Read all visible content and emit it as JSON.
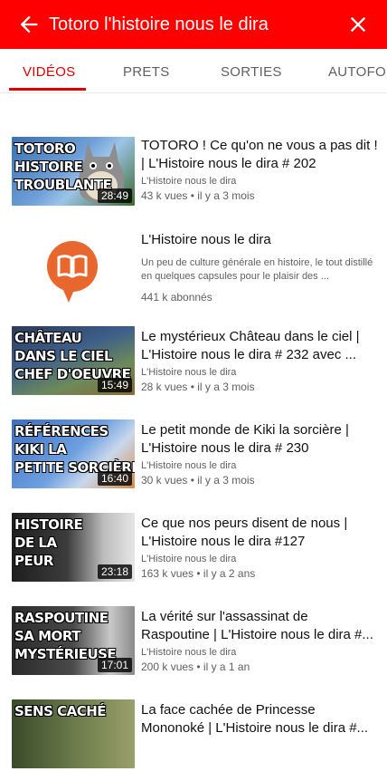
{
  "header": {
    "title": "Totoro l'histoire nous le dira",
    "back_icon": "arrow-left-icon",
    "close_icon": "close-icon",
    "background": "#ff0000"
  },
  "tabs": [
    {
      "label": "VIDÉOS",
      "active": true
    },
    {
      "label": "PRETS",
      "active": false
    },
    {
      "label": "SORTIES",
      "active": false
    },
    {
      "label": "AUTOFOR",
      "active": false
    }
  ],
  "results": {
    "video1": {
      "thumb_text": "TOTORO\nHISTOIRE\nTROUBLANTE",
      "duration": "28:49",
      "title": "TOTORO ! Ce qu'on ne vous a pas dit ! | L'Histoire nous le dira # 202",
      "channel": "L'Histoire nous le dira",
      "stats": "43 k vues • il y a 3 mois"
    },
    "channel": {
      "name": "L'Histoire nous le dira",
      "description": "Un peu de culture générale en histoire, le tout distillé en quelques capsules pour le plaisir des ...",
      "subscribers": "441 k abonnés",
      "icon": "book-icon"
    },
    "video2": {
      "thumb_text": "CHÂTEAU\nDANS LE CIEL\nCHEF D'OEUVRE",
      "duration": "15:49",
      "title": "Le mystérieux Château dans le ciel | L'Histoire nous le dira # 232 avec ...",
      "channel": "L'Histoire nous le dira",
      "stats": "28 k vues • il y a 3 mois"
    },
    "video3": {
      "thumb_text": "RÉFÉRENCES\nKIKI LA\nPETITE SORCIÈRE",
      "duration": "16:40",
      "title": "Le petit monde de Kiki la sorcière | L'Histoire nous le dira # 230",
      "channel": "L'Histoire nous le dira",
      "stats": "30 k vues • il y a 3 mois"
    },
    "video4": {
      "thumb_text": "HISTOIRE\nDE LA\nPEUR",
      "duration": "23:18",
      "title": "Ce que nos peurs disent de nous | L'Histoire nous le dira #127",
      "channel": "L'Histoire nous le dira",
      "stats": "163 k vues • il y a 2 ans"
    },
    "video5": {
      "thumb_text": "RASPOUTINE\nSA MORT\nMYSTÉRIEUSE",
      "duration": "17:01",
      "title": "La vérité sur l'assassinat de Raspoutine | L'Histoire nous le dira #...",
      "channel": "L'Histoire nous le dira",
      "stats": "200 k vues • il y a 1 an"
    },
    "video6": {
      "thumb_text": "SENS CACHÉ",
      "duration": "",
      "title": "La face cachée de Princesse Mononoké | L'Histoire nous le dira #..."
    }
  }
}
